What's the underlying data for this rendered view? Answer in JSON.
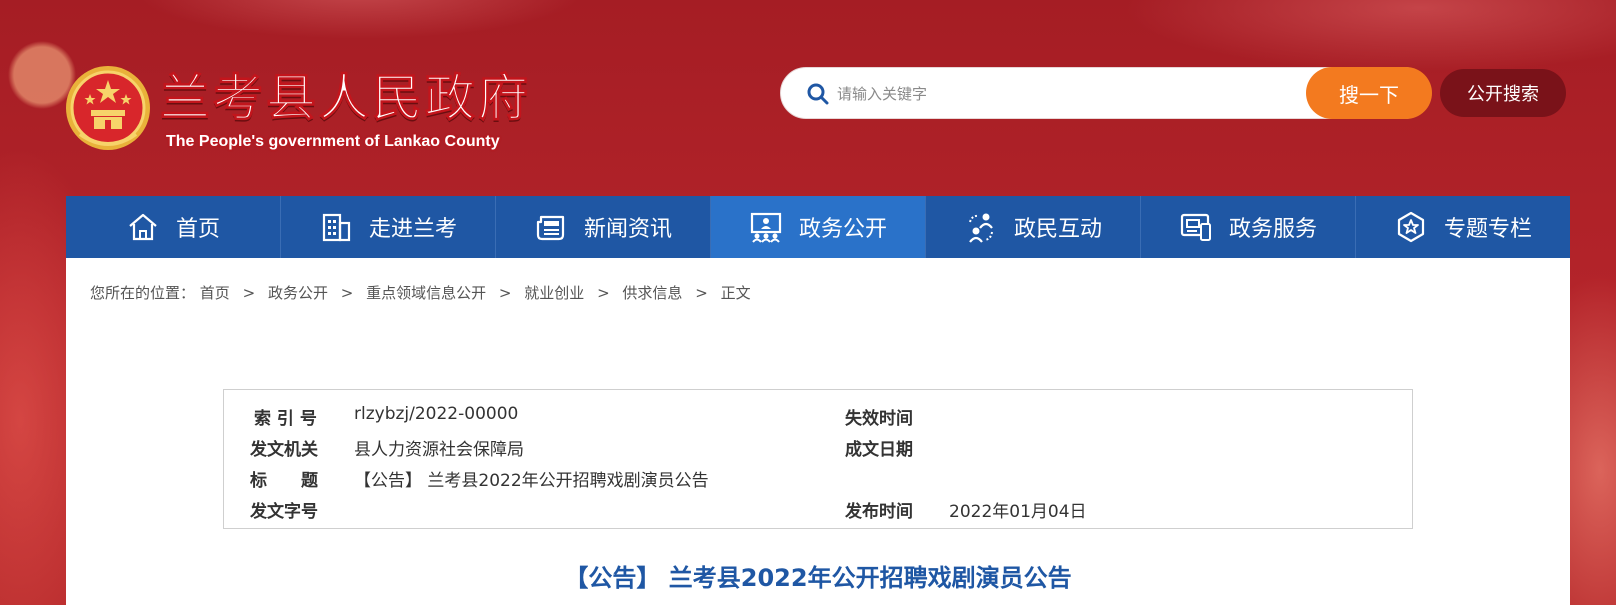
{
  "header": {
    "site_title": "兰考县人民政府",
    "site_subtitle": "The People's government of Lankao County",
    "search": {
      "placeholder": "请输入关键字",
      "button_label": "搜一下"
    },
    "public_search_label": "公开搜索"
  },
  "nav": {
    "items": [
      {
        "label": "首页",
        "icon": "home-icon"
      },
      {
        "label": "走进兰考",
        "icon": "building-icon"
      },
      {
        "label": "新闻资讯",
        "icon": "newspaper-icon"
      },
      {
        "label": "政务公开",
        "icon": "presentation-icon",
        "active": true
      },
      {
        "label": "政民互动",
        "icon": "people-interaction-icon"
      },
      {
        "label": "政务服务",
        "icon": "service-terminal-icon"
      },
      {
        "label": "专题专栏",
        "icon": "badge-star-icon"
      }
    ]
  },
  "breadcrumb": {
    "prefix": "您所在的位置：",
    "items": [
      "首页",
      "政务公开",
      "重点领域信息公开",
      "就业创业",
      "供求信息",
      "正文"
    ],
    "separator": ">"
  },
  "meta": {
    "index_label": "索 引 号",
    "index_value": "rlzybzj/2022-00000",
    "expiry_label": "失效时间",
    "expiry_value": "",
    "issuer_label": "发文机关",
    "issuer_value": "县人力资源社会保障局",
    "written_date_label": "成文日期",
    "written_date_value": "",
    "title_label": "标　　题",
    "title_value": "【公告】 兰考县2022年公开招聘戏剧演员公告",
    "doc_number_label": "发文字号",
    "doc_number_value": "",
    "publish_label": "发布时间",
    "publish_value": "2022年01月04日"
  },
  "document": {
    "title": "【公告】 兰考县2022年公开招聘戏剧演员公告"
  },
  "colors": {
    "header_red": "#a51d24",
    "nav_blue": "#1f57a4",
    "nav_active": "#2a72c9",
    "search_orange": "#f37a1f",
    "title_blue": "#1f57a4"
  }
}
